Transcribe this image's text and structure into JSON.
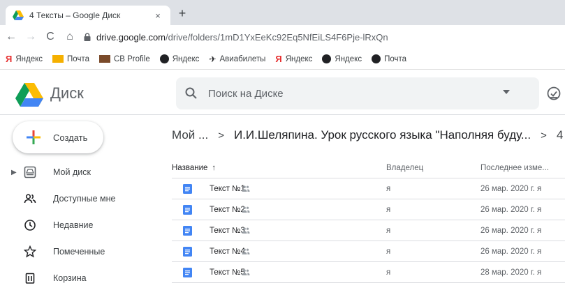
{
  "browser": {
    "tab": {
      "title": "4 Тексты – Google Диск",
      "close": "×"
    },
    "new_tab": "+",
    "nav": {
      "back": "←",
      "forward": "→",
      "reload": "C",
      "home": "⌂"
    },
    "url": {
      "host": "drive.google.com",
      "path": "/drive/folders/1mD1YxEeKc92Eq5NfEiLS4F6Pje-lRxQn"
    },
    "bookmarks": [
      {
        "label": "Яндекс",
        "icon": "yandex-icon"
      },
      {
        "label": "Почта",
        "icon": "mail-icon"
      },
      {
        "label": "CB Profile",
        "icon": "profile-icon"
      },
      {
        "label": "Яндекс",
        "icon": "browser-icon"
      },
      {
        "label": "Авиабилеты",
        "icon": "plane-icon"
      },
      {
        "label": "Яндекс",
        "icon": "yandex-icon"
      },
      {
        "label": "Яндекс",
        "icon": "browser-icon"
      },
      {
        "label": "Почта",
        "icon": "browser-icon"
      }
    ]
  },
  "drive": {
    "product_name": "Диск",
    "search": {
      "placeholder": "Поиск на Диске"
    },
    "create_label": "Создать",
    "sidebar": [
      {
        "label": "Мой диск",
        "icon": "my-drive-icon"
      },
      {
        "label": "Доступные мне",
        "icon": "shared-with-me-icon"
      },
      {
        "label": "Недавние",
        "icon": "recent-icon"
      },
      {
        "label": "Помеченные",
        "icon": "starred-icon"
      },
      {
        "label": "Корзина",
        "icon": "trash-icon"
      }
    ],
    "breadcrumb": {
      "root": "Мой ...",
      "sep1": ">",
      "current": "И.И.Шеляпина. Урок русского языка \"Наполняя буду...",
      "sep2": ">",
      "overflow": "4"
    },
    "columns": {
      "name": "Название",
      "sort": "↑",
      "owner": "Владелец",
      "modified": "Последнее изме..."
    },
    "files": [
      {
        "name": "Текст №1",
        "owner": "я",
        "modified": "26 мар. 2020 г. я"
      },
      {
        "name": "Текст №2",
        "owner": "я",
        "modified": "26 мар. 2020 г. я"
      },
      {
        "name": "Текст №3",
        "owner": "я",
        "modified": "26 мар. 2020 г. я"
      },
      {
        "name": "Текст №4",
        "owner": "я",
        "modified": "26 мар. 2020 г. я"
      },
      {
        "name": "Текст №5",
        "owner": "я",
        "modified": "28 мар. 2020 г. я"
      }
    ]
  },
  "colors": {
    "accent": "#1a73e8",
    "doc_icon": "#4285f4",
    "chrome_bg": "#dee1e6",
    "search_bg": "#f1f3f4"
  }
}
